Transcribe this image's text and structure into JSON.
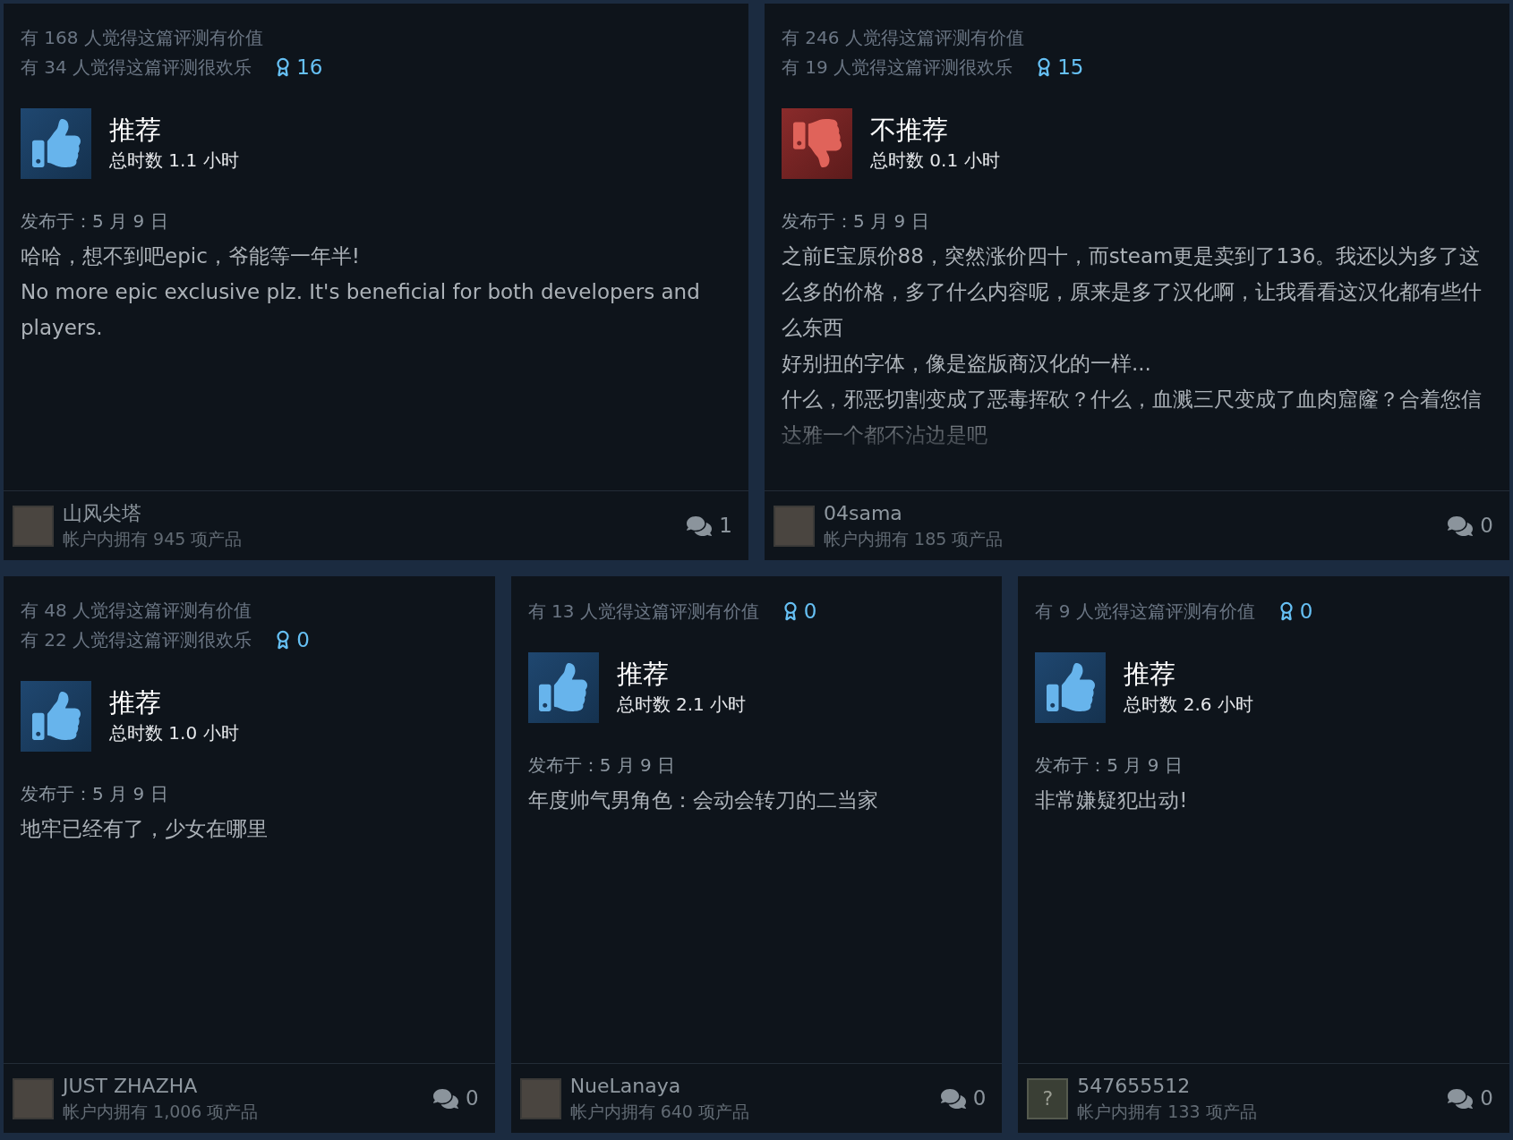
{
  "reviews": [
    {
      "helpful": "有 168 人觉得这篇评测有价值",
      "funny": "有 34 人觉得这篇评测很欢乐",
      "awards": "16",
      "verdict": {
        "kind": "recommended",
        "label": "推荐",
        "hours": "总时数 1.1 小时"
      },
      "posted": "发布于：5 月 9 日",
      "paragraphs": [
        "哈哈，想不到吧epic，爷能等一年半!",
        "No more epic exclusive plz. It's beneficial for both developers and players."
      ],
      "truncated": false,
      "author": {
        "name": "山风尖塔",
        "products": "帐户内拥有 945 项产品",
        "kind": "image"
      },
      "comments": "1"
    },
    {
      "helpful": "有 246 人觉得这篇评测有价值",
      "funny": "有 19 人觉得这篇评测很欢乐",
      "awards": "15",
      "verdict": {
        "kind": "not_recommended",
        "label": "不推荐",
        "hours": "总时数 0.1 小时"
      },
      "posted": "发布于：5 月 9 日",
      "paragraphs": [
        "之前E宝原价88，突然涨价四十，而steam更是卖到了136。我还以为多了这么多的价格，多了什么内容呢，原来是多了汉化啊，让我看看这汉化都有些什么东西",
        "好别扭的字体，像是盗版商汉化的一样...",
        "什么，邪恶切割变成了恶毒挥砍？什么，血溅三尺变成了血肉窟窿？合着您信达雅一个都不沾边是吧"
      ],
      "truncated": true,
      "author": {
        "name": "04sama",
        "products": "帐户内拥有 185 项产品",
        "kind": "image"
      },
      "comments": "0"
    },
    {
      "helpful": "有 48 人觉得这篇评测有价值",
      "funny": "有 22 人觉得这篇评测很欢乐",
      "awards": "0",
      "verdict": {
        "kind": "recommended",
        "label": "推荐",
        "hours": "总时数 1.0 小时"
      },
      "posted": "发布于：5 月 9 日",
      "paragraphs": [
        "地牢已经有了，少女在哪里"
      ],
      "truncated": false,
      "author": {
        "name": "JUST ZHAZHA",
        "products": "帐户内拥有 1,006 项产品",
        "kind": "image"
      },
      "comments": "0"
    },
    {
      "helpful": "有 13 人觉得这篇评测有价值",
      "awards": "0",
      "verdict": {
        "kind": "recommended",
        "label": "推荐",
        "hours": "总时数 2.1 小时"
      },
      "posted": "发布于：5 月 9 日",
      "paragraphs": [
        "年度帅气男角色：会动会转刀的二当家"
      ],
      "truncated": false,
      "author": {
        "name": "NueLanaya",
        "products": "帐户内拥有 640 项产品",
        "kind": "image"
      },
      "comments": "0"
    },
    {
      "helpful": "有 9 人觉得这篇评测有价值",
      "awards": "0",
      "verdict": {
        "kind": "recommended",
        "label": "推荐",
        "hours": "总时数 2.6 小时"
      },
      "posted": "发布于：5 月 9 日",
      "paragraphs": [
        "非常嫌疑犯出动!"
      ],
      "truncated": false,
      "author": {
        "name": "547655512",
        "products": "帐户内拥有 133 项产品",
        "kind": "placeholder",
        "avatar_glyph": "?"
      },
      "comments": "0"
    }
  ]
}
